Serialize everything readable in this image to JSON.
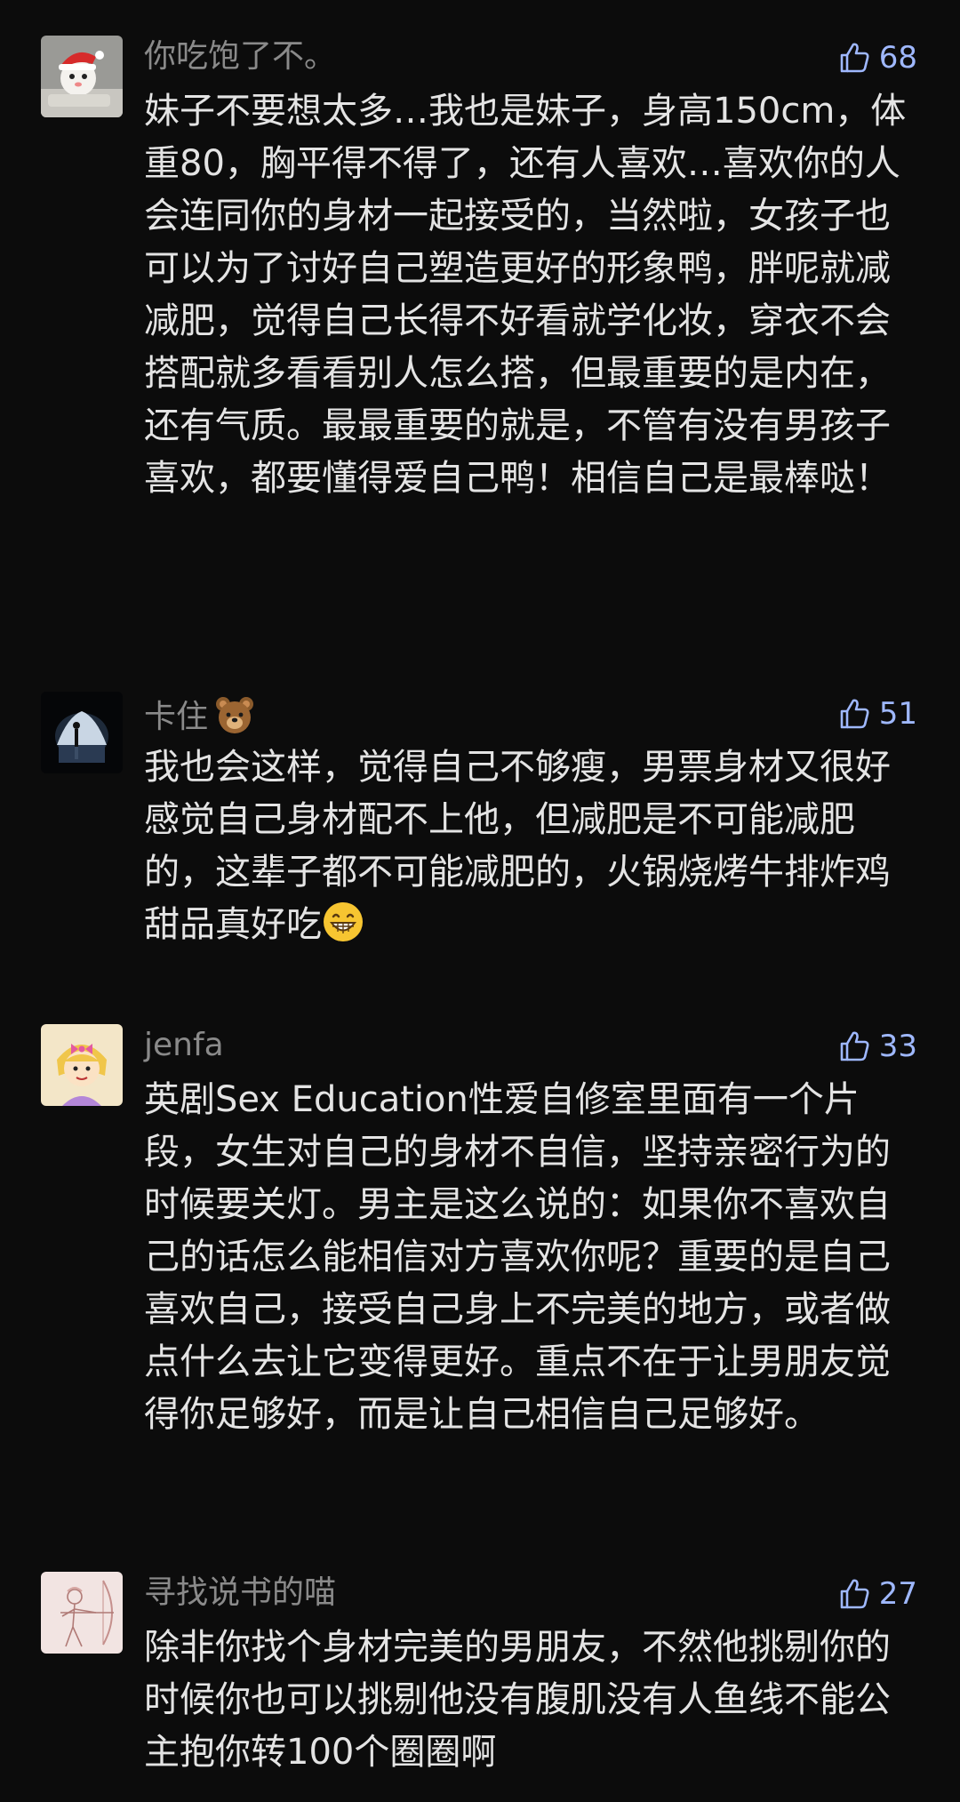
{
  "comments": [
    {
      "username": "你吃饱了不。",
      "likes": "68",
      "avatar_icon": "santa-hat-avatar-icon",
      "text": "妹子不要想太多…我也是妹子，身高150cm，体重80，胸平得不得了，还有人喜欢…喜欢你的人会连同你的身材一起接受的，当然啦，女孩子也可以为了讨好自己塑造更好的形象鸭，胖呢就减减肥，觉得自己长得不好看就学化妆，穿衣不会搭配就多看看别人怎么搭，但最重要的是内在，还有气质。最最重要的就是，不管有没有男孩子喜欢，都要懂得爱自己鸭！相信自己是最棒哒！"
    },
    {
      "username": "卡住",
      "username_emoji": "bear-face-emoji",
      "likes": "51",
      "avatar_icon": "silhouette-avatar-icon",
      "text": "我也会这样，觉得自己不够瘦，男票身材又很好感觉自己身材配不上他，但减肥是不可能减肥的，这辈子都不可能减肥的，火锅烧烤牛排炸鸡甜品真好吃",
      "text_emoji": "grinning-face-emoji"
    },
    {
      "username": "jenfa",
      "likes": "33",
      "avatar_icon": "cartoon-girl-avatar-icon",
      "text": "英剧Sex Education性爱自修室里面有一个片段，女生对自己的身材不自信，坚持亲密行为的时候要关灯。男主是这么说的：如果你不喜欢自己的话怎么能相信对方喜欢你呢？重要的是自己喜欢自己，接受自己身上不完美的地方，或者做点什么去让它变得更好。重点不在于让男朋友觉得你足够好，而是让自己相信自己足够好。"
    },
    {
      "username": "寻找说书的喵",
      "likes": "27",
      "avatar_icon": "archer-sketch-avatar-icon",
      "text": "除非你找个身材完美的男朋友，不然他挑剔你的时候你也可以挑剔他没有腹肌没有人鱼线不能公主抱你转100个圈圈啊"
    }
  ],
  "colors": {
    "background": "#0c0c0c",
    "username": "#8a8a8a",
    "text": "#e4e4e4",
    "like_accent": "#9fb8ff"
  }
}
